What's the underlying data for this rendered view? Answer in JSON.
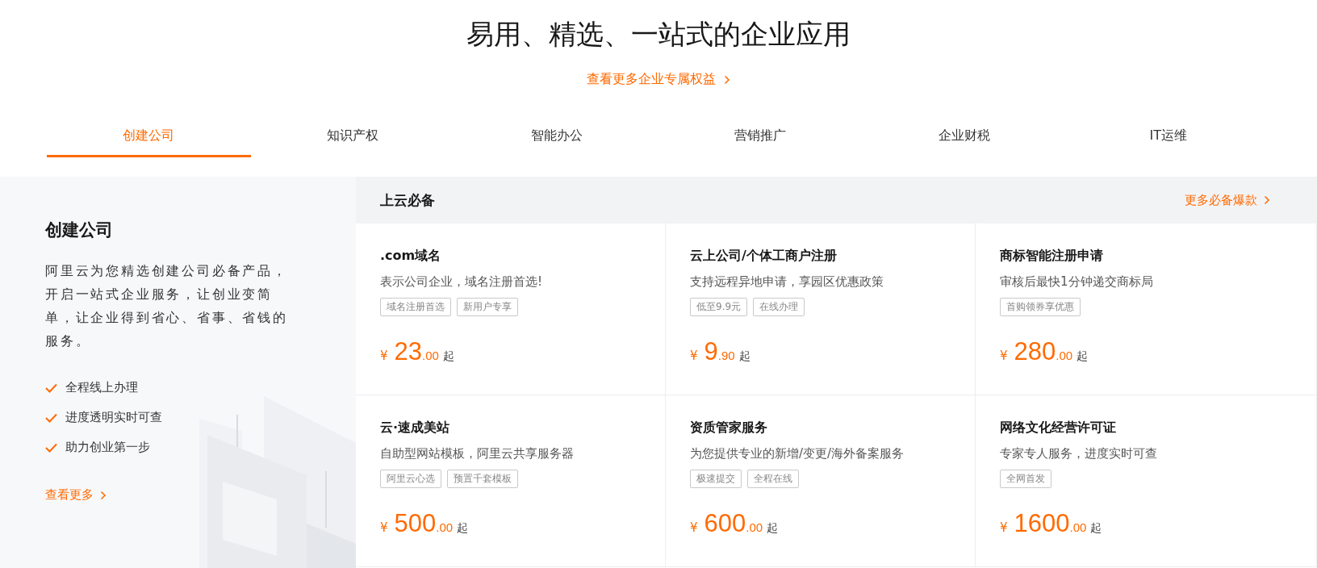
{
  "heading": {
    "title": "易用、精选、一站式的企业应用",
    "link": "查看更多企业专属权益"
  },
  "tabs": [
    {
      "label": "创建公司",
      "selected": true
    },
    {
      "label": "知识产权",
      "selected": false
    },
    {
      "label": "智能办公",
      "selected": false
    },
    {
      "label": "营销推广",
      "selected": false
    },
    {
      "label": "企业财税",
      "selected": false
    },
    {
      "label": "IT运维",
      "selected": false
    }
  ],
  "intro": {
    "title": "创建公司",
    "description": "阿里云为您精选创建公司必备产品，开启一站式企业服务，让创业变简单，让企业得到省心、省事、省钱的服务。",
    "features": [
      "全程线上办理",
      "进度透明实时可查",
      "助力创业第一步"
    ],
    "link": "查看更多",
    "kind": "picture"
  },
  "section": {
    "title": "上云必备",
    "link": "更多必备爆款"
  },
  "products": [
    {
      "name": ".com域名",
      "desc": "表示公司企业，域名注册首选!",
      "tags": [
        "域名注册首选",
        "新用户专享"
      ],
      "currency": "¥",
      "price": "23",
      "decimals": ".00",
      "suffix": "起"
    },
    {
      "name": "云上公司/个体工商户注册",
      "desc": "支持远程异地申请，享园区优惠政策",
      "tags": [
        "低至9.9元",
        "在线办理"
      ],
      "currency": "¥",
      "price": "9",
      "decimals": ".90",
      "suffix": "起"
    },
    {
      "name": "商标智能注册申请",
      "desc": "审核后最快1分钟递交商标局",
      "tags": [
        "首购领券享优惠"
      ],
      "currency": "¥",
      "price": "280",
      "decimals": ".00",
      "suffix": "起"
    },
    {
      "name": "云·速成美站",
      "desc": "自助型网站模板，阿里云共享服务器",
      "tags": [
        "阿里云心选",
        "预置千套模板"
      ],
      "currency": "¥",
      "price": "500",
      "decimals": ".00",
      "suffix": "起"
    },
    {
      "name": "资质管家服务",
      "desc": "为您提供专业的新增/变更/海外备案服务",
      "tags": [
        "极速提交",
        "全程在线"
      ],
      "currency": "¥",
      "price": "600",
      "decimals": ".00",
      "suffix": "起"
    },
    {
      "name": "网络文化经营许可证",
      "desc": "专家专人服务，进度实时可查",
      "tags": [
        "全网首发"
      ],
      "currency": "¥",
      "price": "1600",
      "decimals": ".00",
      "suffix": "起"
    }
  ]
}
